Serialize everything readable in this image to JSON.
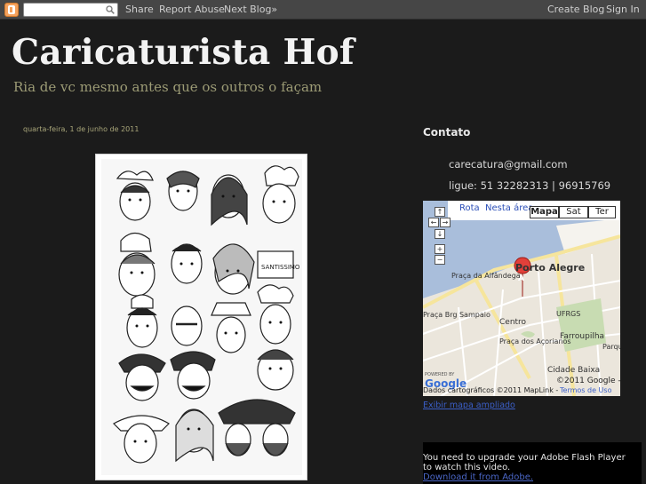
{
  "navbar": {
    "search_placeholder": "",
    "share": "Share",
    "report_abuse": "Report Abuse",
    "next_blog": "Next Blog»",
    "create_blog": "Create Blog",
    "sign_in": "Sign In"
  },
  "header": {
    "title": "Caricaturista Hof",
    "description": "Ria de vc mesmo antes que os outros o façam"
  },
  "post": {
    "date": "quarta-feira, 1 de junho de 2011"
  },
  "sidebar": {
    "contact_heading": "Contato",
    "email": "carecatura@gmail.com",
    "phone": "ligue: 51 32282313 | 96915769",
    "map": {
      "link_rota": "Rota",
      "link_nesta_area": "Nesta área",
      "type_map": "Mapa",
      "type_sat": "Sat",
      "type_ter": "Ter",
      "city": "Porto Alegre",
      "marker": "A",
      "labels": [
        "Praça da Alfândega",
        "Praça Brg Sampaio",
        "Centro",
        "UFRGS",
        "Farroupilha",
        "Praça dos Açorianos",
        "Cidade Baixa",
        "Parque"
      ],
      "copyright": "©2011 Google -",
      "attribution": "Dados cartográficos ©2011 MapLink -",
      "terms": "Termos de Uso",
      "powered_by": "POWERED BY",
      "google": "Google",
      "enlarge_link": "Exibir mapa ampliado"
    },
    "flash": {
      "line1": "You need to upgrade your Adobe Flash Player",
      "line2": "to watch this video.",
      "link": "Download it from Adobe."
    }
  },
  "colors": {
    "background": "#1b1b1b",
    "navbar": "#464646",
    "title": "#f3f3f3",
    "description": "#9c9b75",
    "link": "#3b5fc8"
  }
}
